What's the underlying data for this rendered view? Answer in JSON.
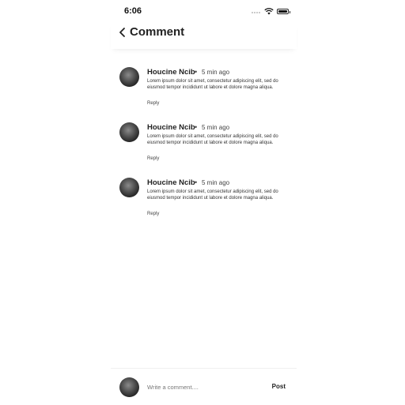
{
  "status_bar": {
    "time": "6:06"
  },
  "header": {
    "title": "Comment"
  },
  "comments": [
    {
      "author": "Houcine Ncib",
      "separator": "•",
      "time_ago": "5 min ago",
      "text": "Lorem ipsum dolor sit amet, consectetur adipiscing elit, sed do eiusmod tempor incididunt ut labore et dolore magna aliqua.",
      "reply_label": "Reply"
    },
    {
      "author": "Houcine Ncib",
      "separator": "•",
      "time_ago": "5 min ago",
      "text": "Lorem ipsum dolor sit amet, consectetur adipiscing elit, sed do eiusmod tempor incididunt ut labore et dolore magna aliqua.",
      "reply_label": "Reply"
    },
    {
      "author": "Houcine Ncib",
      "separator": "•",
      "time_ago": "5 min ago",
      "text": "Lorem ipsum dolor sit amet, consectetur adipiscing elit, sed do eiusmod tempor incididunt ut labore et dolore magna aliqua.",
      "reply_label": "Reply"
    }
  ],
  "composer": {
    "placeholder": "Write a comment....",
    "post_label": "Post"
  }
}
